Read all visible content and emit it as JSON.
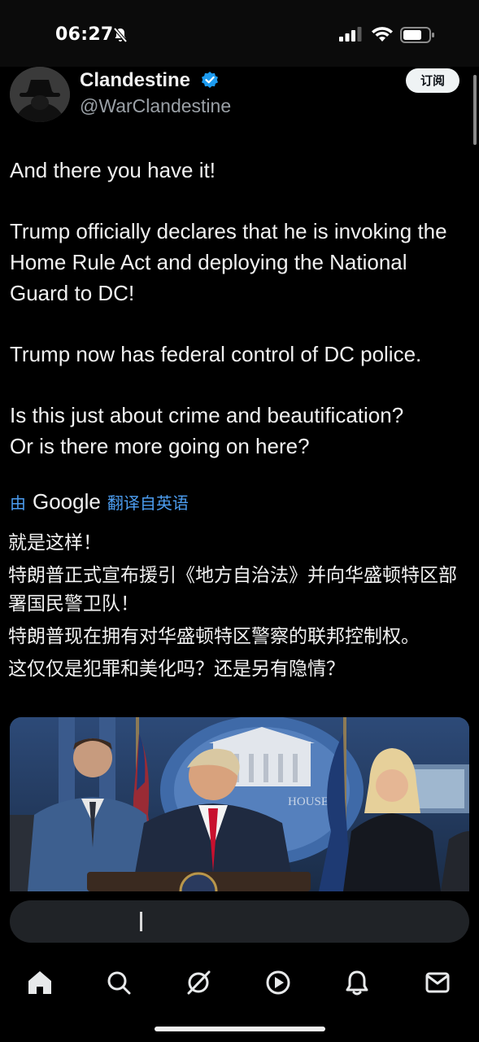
{
  "status_bar": {
    "time": "06:27"
  },
  "profile": {
    "display_name": "Clandestine",
    "handle": "@WarClandestine",
    "follow_label": "订阅"
  },
  "tweet": {
    "paragraphs": [
      "And there you have it!",
      "Trump officially declares that he is invoking the Home Rule Act and deploying the National Guard to DC!",
      "Trump now has federal control of DC police.",
      "Is this just about crime and beautification?\nOr is there more going on here?"
    ]
  },
  "translation": {
    "prefix": "由",
    "provider": "Google",
    "suffix": "翻译自英语",
    "paragraphs": [
      "就是这样！",
      "特朗普正式宣布援引《地方自治法》并向华盛顿特区部署国民警卫队！",
      "特朗普现在拥有对华盛顿特区警察的联邦控制权。",
      "这仅仅是犯罪和美化吗？还是另有隐情？"
    ]
  },
  "media": {
    "sign_text": "HOUSE"
  },
  "nav": {
    "items": [
      "home-icon",
      "search-icon",
      "grok-icon",
      "play-icon",
      "notifications-icon",
      "messages-icon"
    ]
  },
  "colors": {
    "link": "#4c9df0",
    "verified": "#1d9bf0",
    "background": "#000000"
  }
}
